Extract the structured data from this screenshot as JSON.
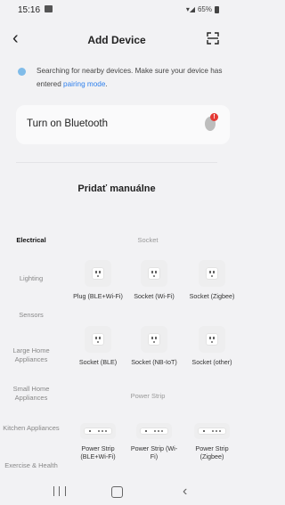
{
  "status_bar": {
    "time": "15:16",
    "battery": "65%"
  },
  "header": {
    "title": "Add Device"
  },
  "notice": {
    "text": "Searching for nearby devices. Make sure your device has entered ",
    "link": "pairing mode",
    "suffix": "."
  },
  "bluetooth": {
    "label": "Turn on Bluetooth",
    "badge": "!"
  },
  "manual_heading": "Pridať manuálne",
  "categories": [
    {
      "label": "Electrical",
      "active": true
    },
    {
      "label": "Lighting"
    },
    {
      "label": "Sensors"
    },
    {
      "label": "Large Home Appliances"
    },
    {
      "label": "Small Home Appliances"
    },
    {
      "label": "Kitchen Appliances"
    },
    {
      "label": "Exercise & Health"
    }
  ],
  "sections": [
    {
      "title": "Socket"
    },
    {
      "title": "Power Strip"
    }
  ],
  "devices": [
    {
      "label": "Plug (BLE+Wi-Fi)"
    },
    {
      "label": "Socket (Wi-Fi)"
    },
    {
      "label": "Socket (Zigbee)"
    },
    {
      "label": "Socket (BLE)"
    },
    {
      "label": "Socket (NB-IoT)"
    },
    {
      "label": "Socket (other)"
    },
    {
      "label": "Power Strip (BLE+Wi-Fi)"
    },
    {
      "label": "Power Strip (Wi-Fi)"
    },
    {
      "label": "Power Strip (Zigbee)"
    }
  ]
}
